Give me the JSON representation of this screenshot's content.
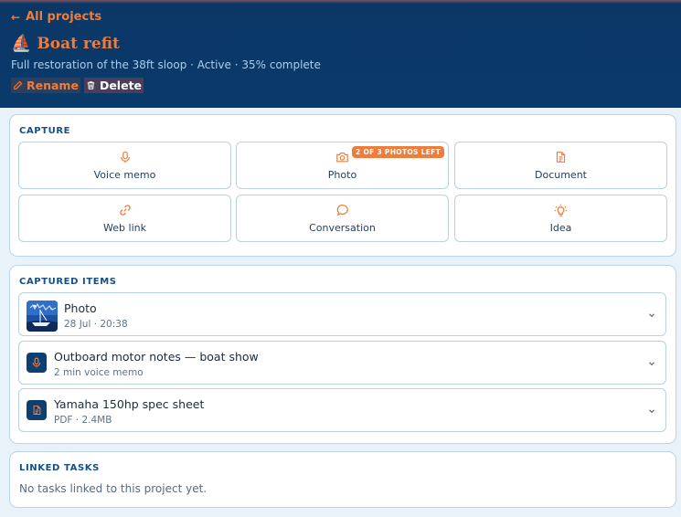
{
  "nav": {
    "back_label": "All projects"
  },
  "project": {
    "emoji": "⛵",
    "title": "Boat refit",
    "subtitle": "Full restoration of the 38ft sloop · Active · 35% complete",
    "rename_label": "Rename",
    "delete_label": "Delete"
  },
  "capture": {
    "heading": "CAPTURE",
    "buttons": [
      {
        "label": "Voice memo",
        "icon": "microphone-icon"
      },
      {
        "label": "Photo",
        "icon": "camera-icon",
        "badge": "2 OF 3 PHOTOS LEFT"
      },
      {
        "label": "Document",
        "icon": "document-icon"
      },
      {
        "label": "Web link",
        "icon": "link-icon"
      },
      {
        "label": "Conversation",
        "icon": "speech-bubble-icon"
      },
      {
        "label": "Idea",
        "icon": "lightbulb-icon"
      }
    ]
  },
  "captured": {
    "heading": "CAPTURED ITEMS",
    "items": [
      {
        "name": "Photo",
        "meta": "28 Jul · 20:38",
        "icon": "photo-thumbnail"
      },
      {
        "name": "Outboard motor notes — boat show",
        "meta": "2 min voice memo",
        "icon": "microphone-icon"
      },
      {
        "name": "Yamaha 150hp spec sheet",
        "meta": "PDF · 2.4MB",
        "icon": "document-icon"
      }
    ]
  },
  "tasks": {
    "heading": "LINKED TASKS",
    "empty_text": "No tasks linked to this project yet."
  },
  "colors": {
    "accent": "#ee7d3c",
    "header_bg": "#0a3a6b",
    "panel_border": "#bcd3e8",
    "page_bg": "#e9f1f9"
  }
}
